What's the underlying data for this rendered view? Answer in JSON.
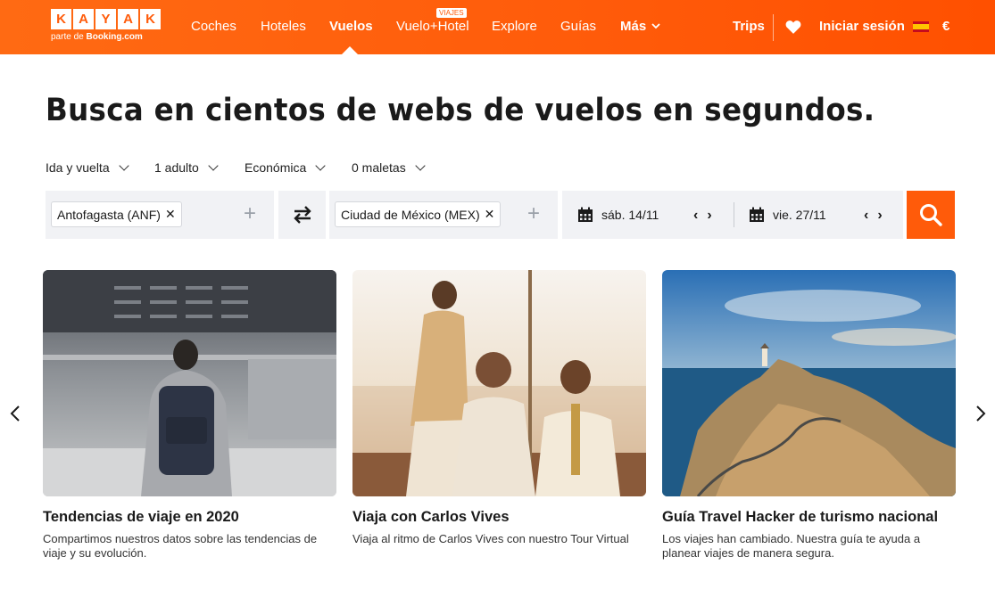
{
  "header": {
    "logo_letters": [
      "K",
      "A",
      "Y",
      "A",
      "K"
    ],
    "logo_sub_prefix": "parte de ",
    "logo_sub_brand": "Booking.com",
    "nav": [
      {
        "label": "Coches"
      },
      {
        "label": "Hoteles"
      },
      {
        "label": "Vuelos",
        "active": true
      },
      {
        "label": "Vuelo+Hotel",
        "badge": "VIAJES"
      },
      {
        "label": "Explore"
      },
      {
        "label": "Guías"
      },
      {
        "label": "Más"
      }
    ],
    "trips": "Trips",
    "login": "Iniciar sesión",
    "currency": "€"
  },
  "title": "Busca en cientos de webs de vuelos en segundos.",
  "options": {
    "trip_type": "Ida y vuelta",
    "passengers": "1 adulto",
    "cabin": "Económica",
    "bags": "0 maletas"
  },
  "search": {
    "origin": "Antofagasta (ANF)",
    "destination": "Ciudad de México (MEX)",
    "depart_date": "sáb. 14/11",
    "return_date": "vie. 27/11"
  },
  "cards": [
    {
      "title": "Tendencias de viaje en 2020",
      "desc": "Compartimos nuestros datos sobre las tendencias de viaje y su evolución."
    },
    {
      "title": "Viaja con Carlos Vives",
      "desc": "Viaja al ritmo de Carlos Vives con nuestro Tour Virtual"
    },
    {
      "title": "Guía Travel Hacker de turismo nacional",
      "desc": "Los viajes han cambiado. Nuestra guía te ayuda a planear viajes de manera segura."
    }
  ],
  "colors": {
    "brand": "#ff5b0a",
    "field_bg": "#f1f2f5"
  }
}
